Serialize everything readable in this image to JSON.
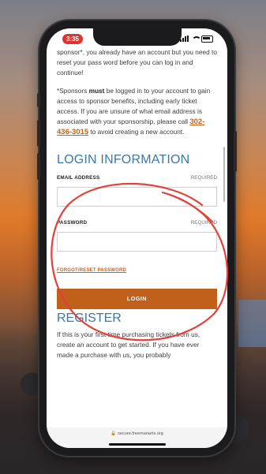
{
  "status": {
    "time": "3:35"
  },
  "content": {
    "intro_text": "sponsor*, you already have an account but you need to reset your pass word before you can log in and continue!",
    "notice_strong": "must",
    "notice_before": "*Sponsors ",
    "notice_after": " be logged in to your account to gain access to sponsor benefits, including early ticket access. If you are unsure of what email address is associated with your sponsorship, please call ",
    "notice_phone": "302-436-3015",
    "notice_end": " to avoid creating a new account."
  },
  "login": {
    "title": "LOGIN INFORMATION",
    "email_label": "EMAIL ADDRESS",
    "email_required": "REQUIRED",
    "email_value": "",
    "password_label": "PASSWORD",
    "password_required": "REQUIRED",
    "password_value": "",
    "forgot_link": "FORGOT/RESET PASSWORD",
    "login_button": "LOGIN"
  },
  "register": {
    "title": "REGISTER",
    "text": "If this is your first time purchasing tickets from us, create an account to get started. If you have ever made a purchase with us, you probably"
  },
  "browser": {
    "url": "secure.freemanarts.org"
  },
  "colors": {
    "accent_orange": "#c0601a",
    "heading_blue": "#3a78a8",
    "annotation_red": "#e2413b"
  }
}
